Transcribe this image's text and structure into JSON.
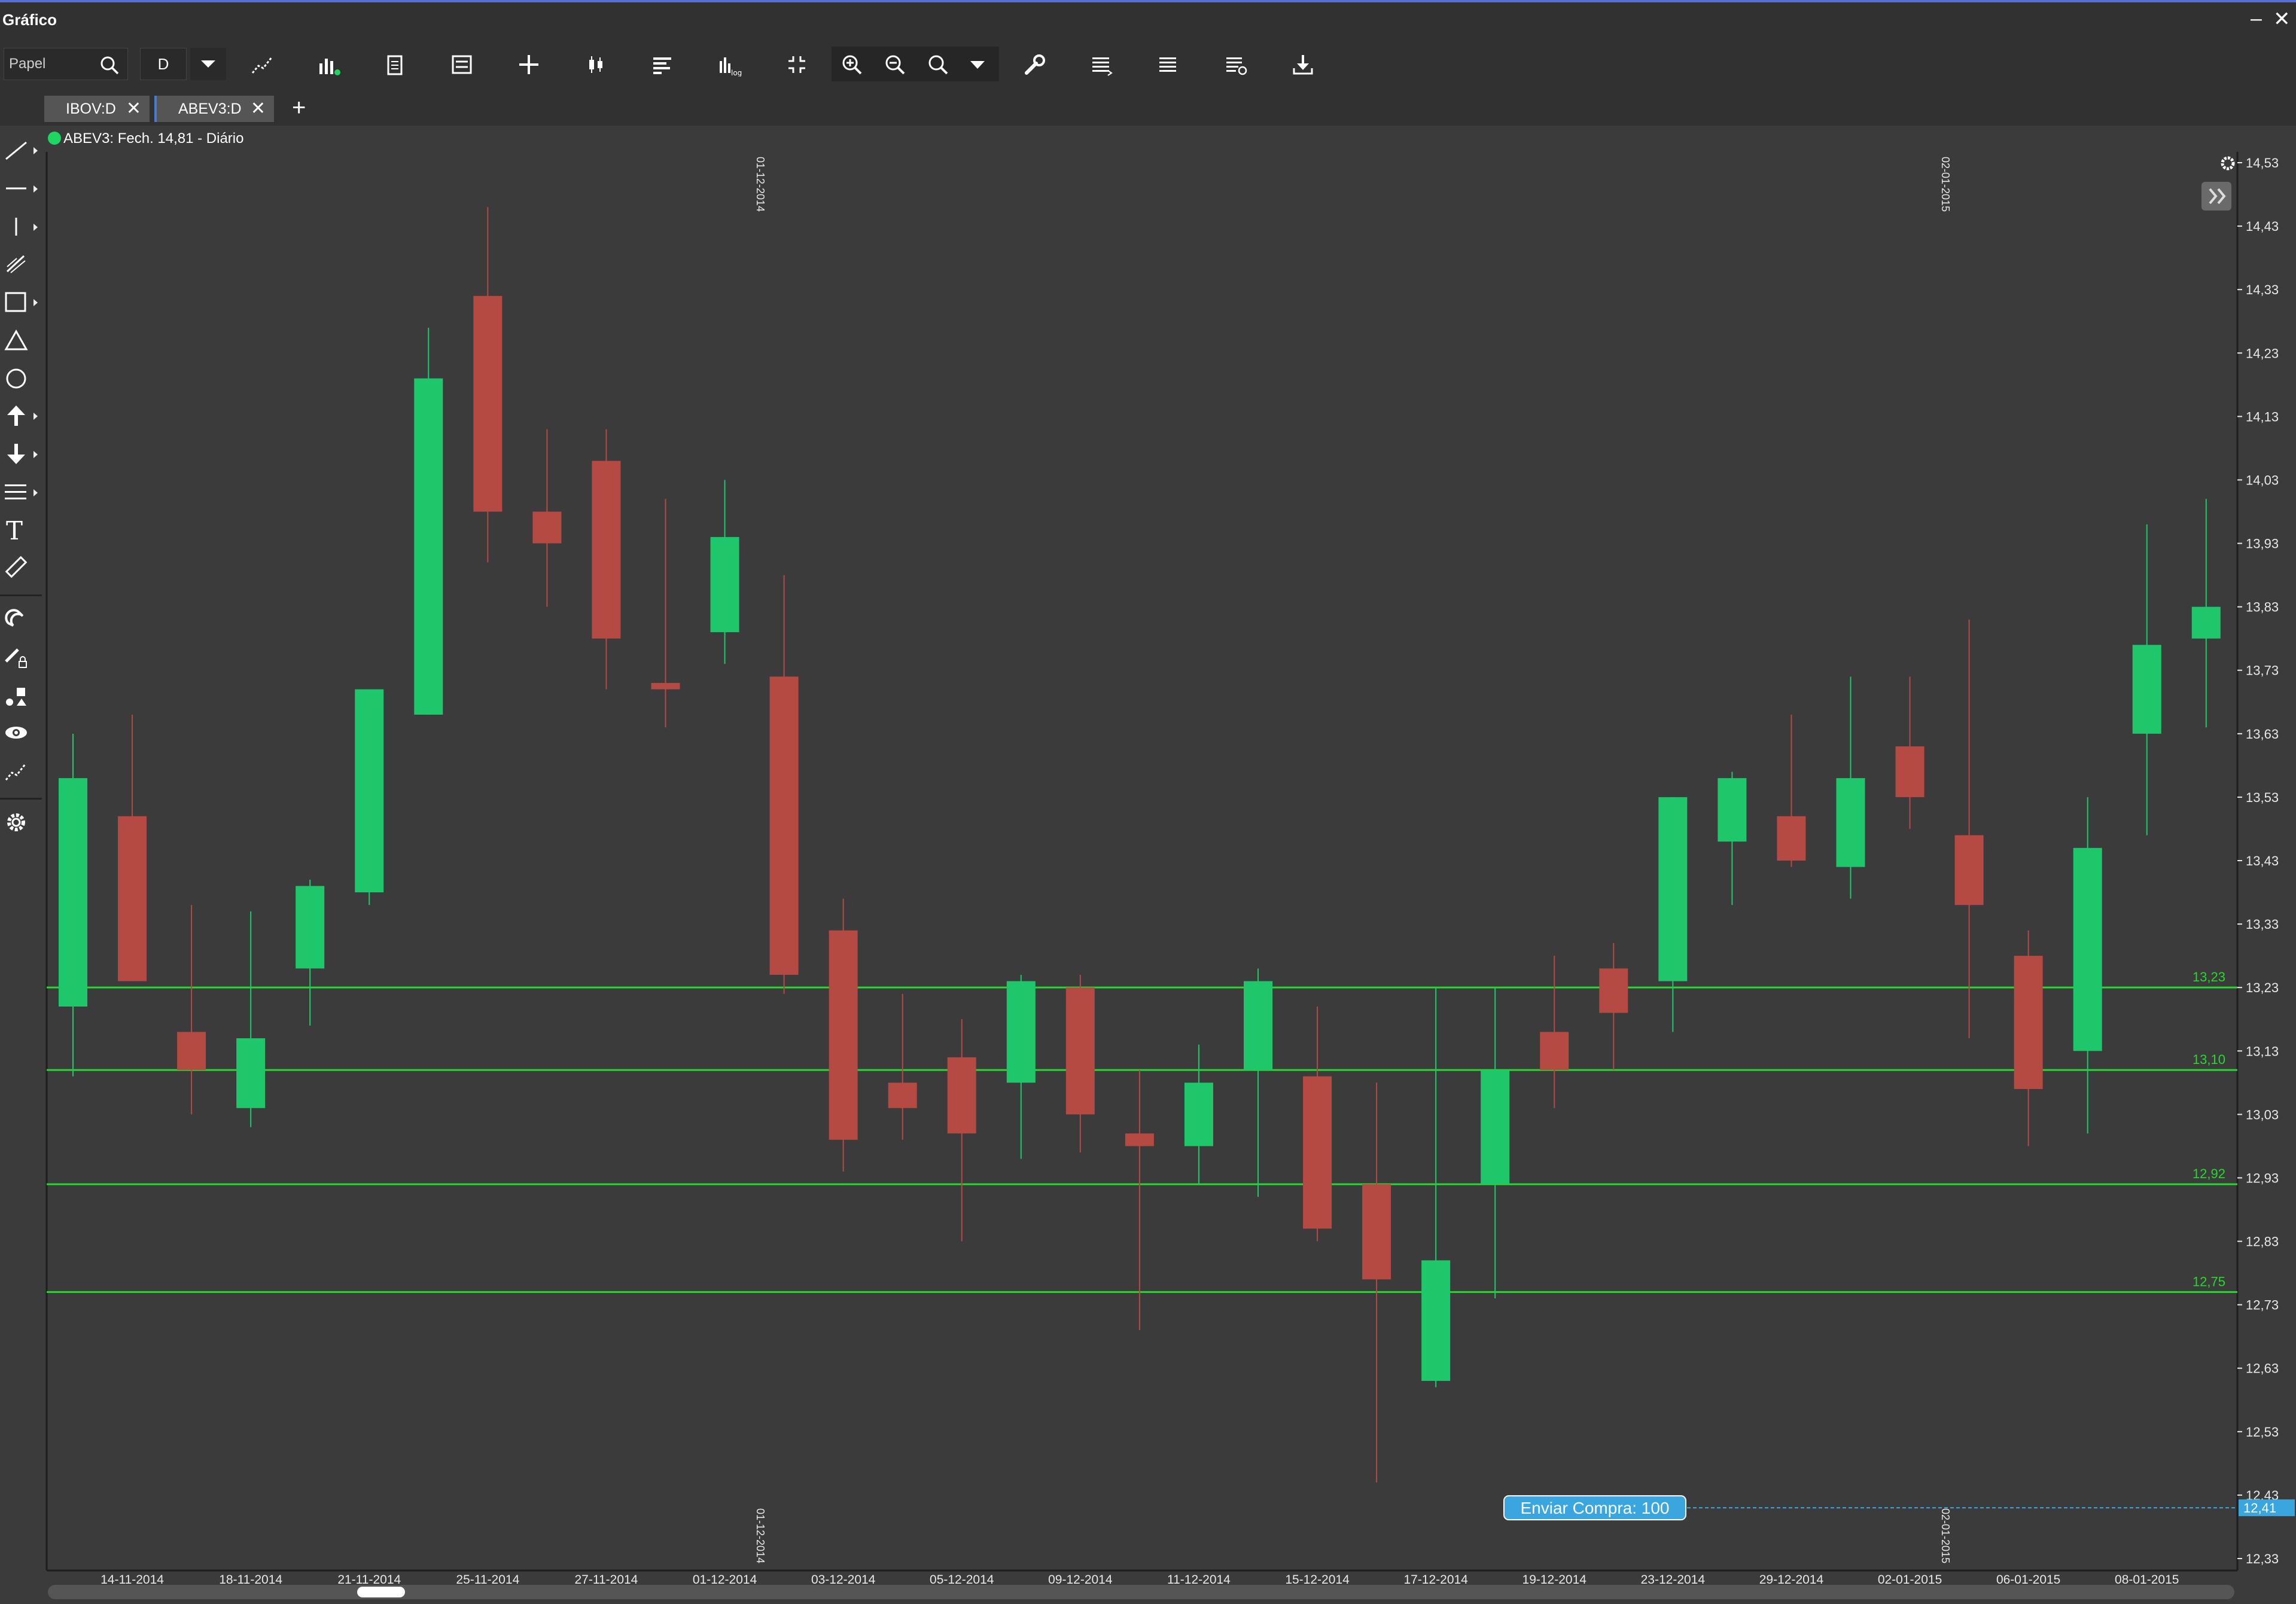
{
  "window": {
    "title": "Gráfico",
    "minimize_glyph": "–",
    "close_glyph": "✕"
  },
  "toolbar": {
    "ticker_placeholder": "Papel",
    "period_value": "D",
    "icons": [
      "search-icon",
      "dropdown-icon",
      "trend-line-icon",
      "indicators-icon",
      "clipboard-icon",
      "template-icon",
      "crosshair-icon",
      "candle-type-icon",
      "horizontal-bars-icon",
      "log-scale-icon",
      "fit-icon",
      "zoom-in-icon",
      "zoom-out-icon",
      "zoom-search-icon",
      "zoom-dropdown-icon",
      "wrench-icon",
      "list-icon",
      "list-alt-icon",
      "list-edit-icon",
      "download-icon"
    ]
  },
  "tabs": [
    {
      "label": "IBOV:D",
      "active": false
    },
    {
      "label": "ABEV3:D",
      "active": true
    }
  ],
  "tab_add_label": "+",
  "legend": {
    "text": "ABEV3: Fech. 14,81 - Diário",
    "status_color": "#1ed760"
  },
  "colors": {
    "up": "#1ec86a",
    "down": "#b44a42",
    "line": "#26d92e",
    "background": "#3b3b3b",
    "axis": "#e8e8e8",
    "order": "#3aa6e0"
  },
  "chart_data": {
    "type": "candlestick",
    "symbol": "ABEV3",
    "interval": "Diário",
    "ylim": [
      12.33,
      14.53
    ],
    "y_ticks": [
      "14,53",
      "14,43",
      "14,33",
      "14,23",
      "14,13",
      "14,03",
      "13,93",
      "13,83",
      "13,73",
      "13,63",
      "13,53",
      "13,43",
      "13,33",
      "13,23",
      "13,13",
      "13,03",
      "12,93",
      "12,83",
      "12,73",
      "12,63",
      "12,53",
      "12,43",
      "12,33"
    ],
    "x_labels": [
      "14-11-2014",
      "18-11-2014",
      "21-11-2014",
      "25-11-2014",
      "27-11-2014",
      "01-12-2014",
      "03-12-2014",
      "05-12-2014",
      "09-12-2014",
      "11-12-2014",
      "15-12-2014",
      "17-12-2014",
      "19-12-2014",
      "23-12-2014",
      "29-12-2014",
      "02-01-2015",
      "06-01-2015",
      "08-01-2015"
    ],
    "period_separators": [
      "01-12-2014",
      "02-01-2015"
    ],
    "candles": [
      {
        "o": 13.2,
        "h": 13.63,
        "l": 13.09,
        "c": 13.56
      },
      {
        "o": 13.5,
        "h": 13.66,
        "l": 13.24,
        "c": 13.24
      },
      {
        "o": 13.16,
        "h": 13.36,
        "l": 13.03,
        "c": 13.1
      },
      {
        "o": 13.04,
        "h": 13.35,
        "l": 13.01,
        "c": 13.15
      },
      {
        "o": 13.26,
        "h": 13.4,
        "l": 13.17,
        "c": 13.39
      },
      {
        "o": 13.38,
        "h": 13.69,
        "l": 13.36,
        "c": 13.7
      },
      {
        "o": 13.66,
        "h": 14.27,
        "l": 13.66,
        "c": 14.19
      },
      {
        "o": 14.32,
        "h": 14.46,
        "l": 13.9,
        "c": 13.98
      },
      {
        "o": 13.98,
        "h": 14.11,
        "l": 13.83,
        "c": 13.93
      },
      {
        "o": 14.06,
        "h": 14.11,
        "l": 13.7,
        "c": 13.78
      },
      {
        "o": 13.71,
        "h": 14.0,
        "l": 13.64,
        "c": 13.7
      },
      {
        "o": 13.79,
        "h": 14.03,
        "l": 13.74,
        "c": 13.94
      },
      {
        "o": 13.72,
        "h": 13.88,
        "l": 13.22,
        "c": 13.25
      },
      {
        "o": 13.32,
        "h": 13.37,
        "l": 12.94,
        "c": 12.99
      },
      {
        "o": 13.08,
        "h": 13.22,
        "l": 12.99,
        "c": 13.04
      },
      {
        "o": 13.12,
        "h": 13.18,
        "l": 12.83,
        "c": 13.0
      },
      {
        "o": 13.08,
        "h": 13.25,
        "l": 12.96,
        "c": 13.24
      },
      {
        "o": 13.23,
        "h": 13.25,
        "l": 12.97,
        "c": 13.03
      },
      {
        "o": 13.0,
        "h": 13.1,
        "l": 12.69,
        "c": 12.98
      },
      {
        "o": 12.98,
        "h": 13.14,
        "l": 12.92,
        "c": 13.08
      },
      {
        "o": 13.1,
        "h": 13.26,
        "l": 12.9,
        "c": 13.24
      },
      {
        "o": 13.09,
        "h": 13.2,
        "l": 12.83,
        "c": 12.85
      },
      {
        "o": 12.92,
        "h": 13.08,
        "l": 12.45,
        "c": 12.77
      },
      {
        "o": 12.61,
        "h": 13.23,
        "l": 12.6,
        "c": 12.8
      },
      {
        "o": 12.92,
        "h": 13.23,
        "l": 12.74,
        "c": 13.1
      },
      {
        "o": 13.16,
        "h": 13.28,
        "l": 13.04,
        "c": 13.1
      },
      {
        "o": 13.26,
        "h": 13.3,
        "l": 13.1,
        "c": 13.19
      },
      {
        "o": 13.24,
        "h": 13.53,
        "l": 13.16,
        "c": 13.53
      },
      {
        "o": 13.46,
        "h": 13.57,
        "l": 13.36,
        "c": 13.56
      },
      {
        "o": 13.5,
        "h": 13.66,
        "l": 13.42,
        "c": 13.43
      },
      {
        "o": 13.42,
        "h": 13.72,
        "l": 13.37,
        "c": 13.56
      },
      {
        "o": 13.61,
        "h": 13.72,
        "l": 13.48,
        "c": 13.53
      },
      {
        "o": 13.47,
        "h": 13.81,
        "l": 13.15,
        "c": 13.36
      },
      {
        "o": 13.28,
        "h": 13.32,
        "l": 12.98,
        "c": 13.07
      },
      {
        "o": 13.13,
        "h": 13.53,
        "l": 13.0,
        "c": 13.45
      },
      {
        "o": 13.63,
        "h": 13.96,
        "l": 13.47,
        "c": 13.77
      },
      {
        "o": 13.78,
        "h": 14.0,
        "l": 13.64,
        "c": 13.83
      }
    ],
    "horizontal_lines": [
      {
        "value": 13.23,
        "label": "13,23"
      },
      {
        "value": 13.1,
        "label": "13,10"
      },
      {
        "value": 12.92,
        "label": "12,92"
      },
      {
        "value": 12.75,
        "label": "12,75"
      }
    ],
    "order_line": {
      "value": 12.41,
      "price_label": "12,41",
      "button_label": "Enviar Compra: 100"
    },
    "grid": false
  }
}
